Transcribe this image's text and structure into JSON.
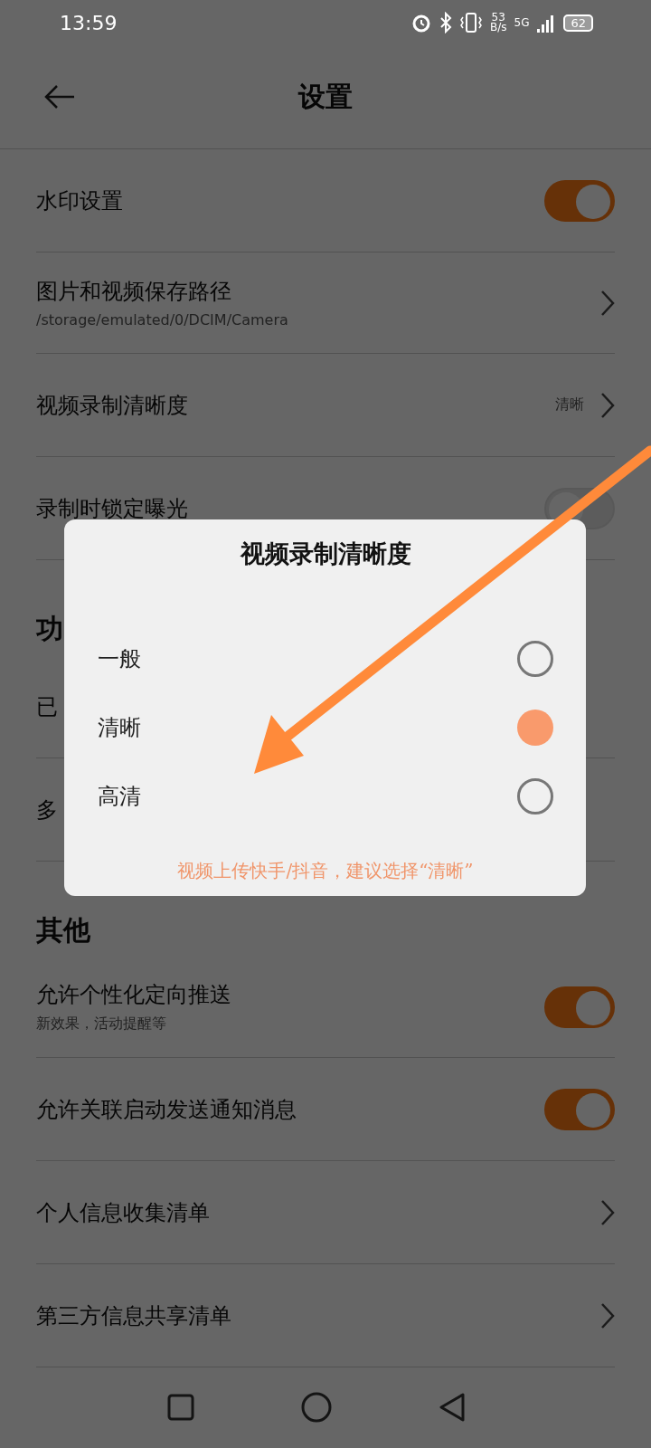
{
  "status_bar": {
    "time": "13:59",
    "net_speed": [
      "53",
      "B/s"
    ],
    "network": "5G",
    "battery": "62"
  },
  "header": {
    "title": "设置"
  },
  "sections": [
    {
      "items": [
        {
          "kind": "toggle",
          "label": "水印设置",
          "on": true
        },
        {
          "kind": "link",
          "label": "图片和视频保存路径",
          "subtitle": "/storage/emulated/0/DCIM/Camera"
        },
        {
          "kind": "link",
          "label": "视频录制清晰度",
          "value": "清晰"
        },
        {
          "kind": "toggle",
          "label": "录制时锁定曝光",
          "on": false
        }
      ]
    },
    {
      "title": "功",
      "items": [
        {
          "kind": "plain",
          "label": "已"
        },
        {
          "kind": "plain",
          "label": "多"
        }
      ]
    },
    {
      "title": "其他",
      "items": [
        {
          "kind": "toggle",
          "label": "允许个性化定向推送",
          "subtitle": "新效果，活动提醒等",
          "on": true
        },
        {
          "kind": "toggle",
          "label": "允许关联启动发送通知消息",
          "on": true
        },
        {
          "kind": "link",
          "label": "个人信息收集清单"
        },
        {
          "kind": "link",
          "label": "第三方信息共享清单"
        }
      ]
    }
  ],
  "dialog": {
    "title": "视频录制清晰度",
    "options": [
      {
        "label": "一般",
        "selected": false
      },
      {
        "label": "清晰",
        "selected": true
      },
      {
        "label": "高清",
        "selected": false
      }
    ],
    "hint": "视频上传快手/抖音，建议选择“清晰”"
  }
}
